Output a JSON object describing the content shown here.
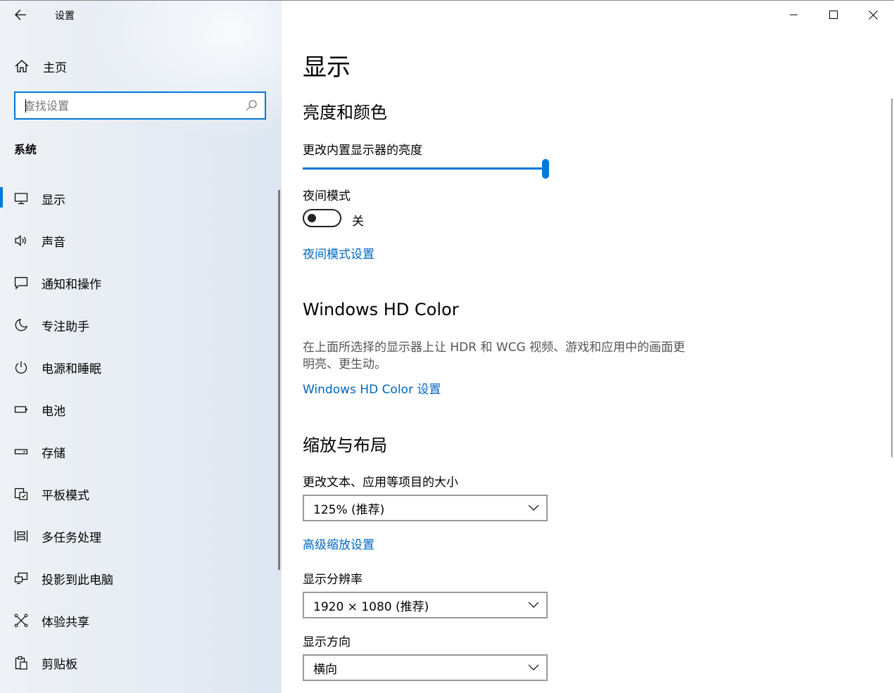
{
  "window": {
    "title": "设置",
    "controls": [
      "minimize",
      "maximize",
      "close"
    ]
  },
  "sidebar": {
    "home_label": "主页",
    "search_placeholder": "查找设置",
    "section_title": "系统",
    "items": [
      {
        "label": "显示",
        "icon": "monitor-icon",
        "active": true
      },
      {
        "label": "声音",
        "icon": "speaker-icon",
        "active": false
      },
      {
        "label": "通知和操作",
        "icon": "notification-icon",
        "active": false
      },
      {
        "label": "专注助手",
        "icon": "moon-icon",
        "active": false
      },
      {
        "label": "电源和睡眠",
        "icon": "power-icon",
        "active": false
      },
      {
        "label": "电池",
        "icon": "battery-icon",
        "active": false
      },
      {
        "label": "存储",
        "icon": "storage-icon",
        "active": false
      },
      {
        "label": "平板模式",
        "icon": "tablet-mode-icon",
        "active": false
      },
      {
        "label": "多任务处理",
        "icon": "multitasking-icon",
        "active": false
      },
      {
        "label": "投影到此电脑",
        "icon": "project-icon",
        "active": false
      },
      {
        "label": "体验共享",
        "icon": "share-icon",
        "active": false
      },
      {
        "label": "剪贴板",
        "icon": "clipboard-icon",
        "active": false
      }
    ]
  },
  "main": {
    "title": "显示",
    "brightness_section": {
      "heading": "亮度和颜色",
      "brightness_label": "更改内置显示器的亮度",
      "brightness_value": 1.0,
      "night_light_label": "夜间模式",
      "night_light_state": "关",
      "night_light_on": false,
      "night_light_link": "夜间模式设置"
    },
    "hdr_section": {
      "heading": "Windows HD Color",
      "description_line1": "在上面所选择的显示器上让 HDR 和 WCG 视频、游戏和应用中的画面更",
      "description_line2": "明亮、更生动。",
      "link": "Windows HD Color 设置"
    },
    "scale_section": {
      "heading": "缩放与布局",
      "scale_label": "更改文本、应用等项目的大小",
      "scale_value": "125% (推荐)",
      "advanced_link": "高级缩放设置",
      "resolution_label": "显示分辨率",
      "resolution_value": "1920 × 1080 (推荐)",
      "orientation_label": "显示方向",
      "orientation_value": "横向"
    }
  },
  "colors": {
    "accent": "#0078d7",
    "link": "#0067c0"
  }
}
